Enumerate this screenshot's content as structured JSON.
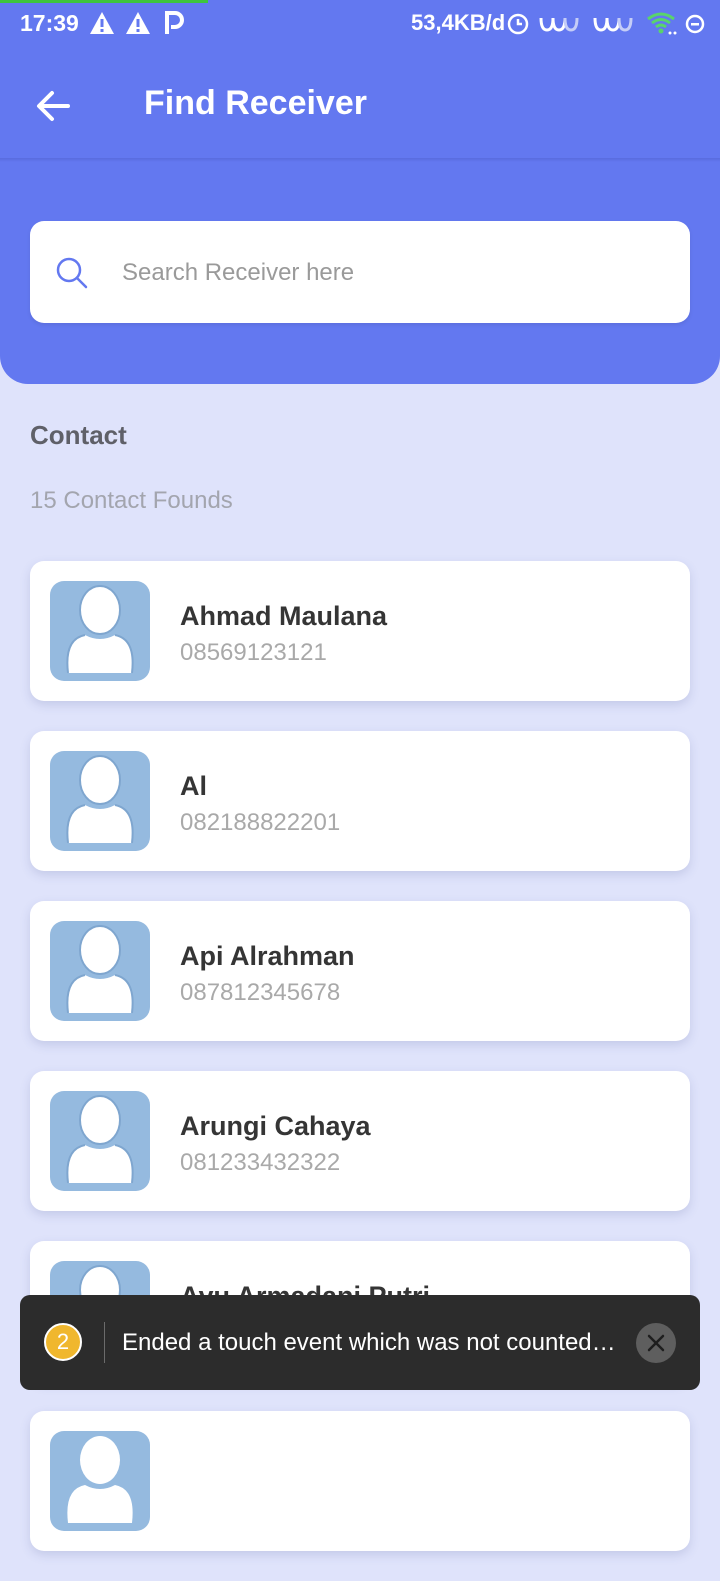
{
  "status_bar": {
    "time": "17:39",
    "left_icons": [
      "warning-icon",
      "warning-icon",
      "parking-icon"
    ],
    "network_speed": "53,4KB/d",
    "right_icons": [
      "alarm-icon",
      "signal-wave-icon",
      "signal-wave-icon",
      "wifi-icon",
      "dnd-icon"
    ]
  },
  "app_bar": {
    "title": "Find Receiver",
    "back_icon": "arrow-left-icon"
  },
  "search": {
    "placeholder": "Search Receiver here",
    "value": "",
    "icon": "search-icon"
  },
  "contacts_section": {
    "title": "Contact",
    "count_text": "15 Contact Founds"
  },
  "contacts": [
    {
      "name": "Ahmad Maulana",
      "phone": "08569123121"
    },
    {
      "name": "Al",
      "phone": "082188822201"
    },
    {
      "name": "Api Alrahman",
      "phone": "087812345678"
    },
    {
      "name": "Arungi Cahaya",
      "phone": "081233432322"
    },
    {
      "name": "Ayu Armadani Putri",
      "phone": ""
    },
    {
      "name": "",
      "phone": ""
    }
  ],
  "toast": {
    "count": "2",
    "message": "Ended a touch event which was not counted…"
  },
  "colors": {
    "primary": "#6378f0",
    "background": "#dfe3fb",
    "avatar": "#95badf",
    "toast_badge": "#f0b72e"
  }
}
